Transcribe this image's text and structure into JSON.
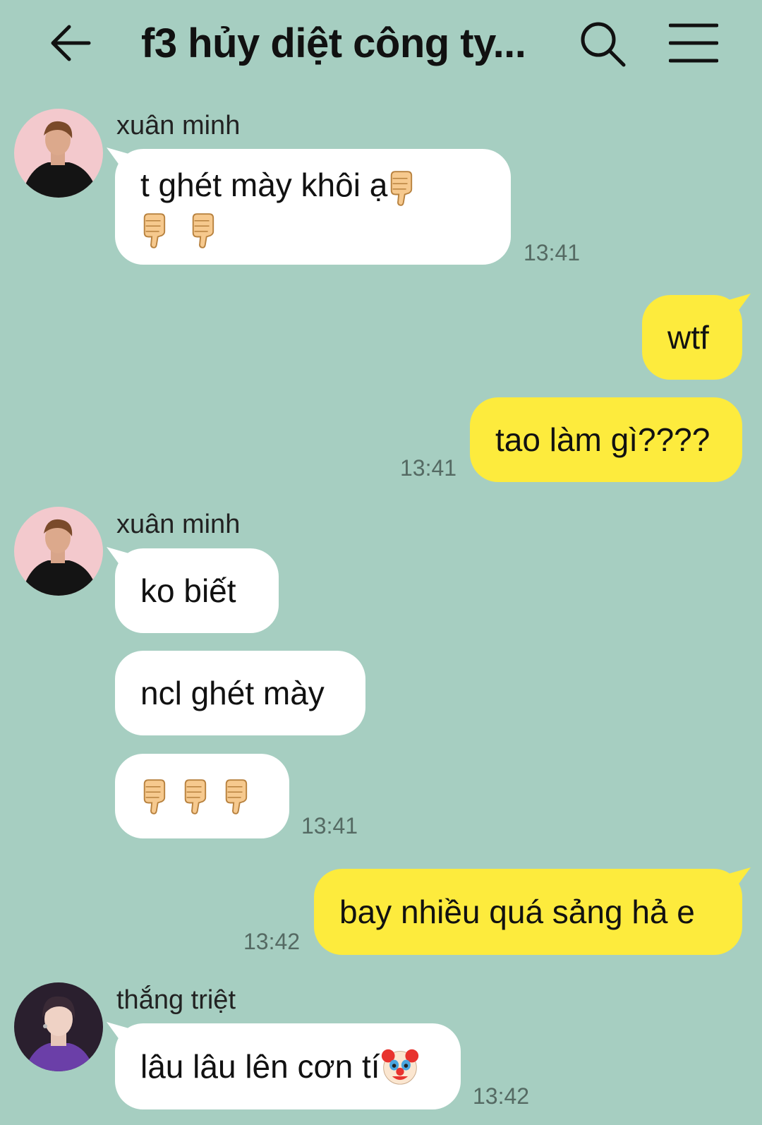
{
  "header": {
    "title": "f3 hủy diệt công ty...",
    "back_icon": "arrow-left-icon",
    "search_icon": "search-icon",
    "menu_icon": "menu-icon"
  },
  "colors": {
    "background": "#a6cec1",
    "incoming_bubble": "#ffffff",
    "outgoing_bubble": "#fdeb3d",
    "timestamp": "#556a63"
  },
  "messages": {
    "m1": {
      "sender": "xuân minh",
      "line1": "t ghét mày khôi ạ",
      "emoji": "thumbs-down-icon",
      "time": "13:41"
    },
    "m2": {
      "text": "wtf"
    },
    "m3": {
      "text": "tao làm gì????",
      "time": "13:41"
    },
    "m4": {
      "sender": "xuân minh",
      "text1": "ko biết",
      "text2": "ncl ghét mày",
      "emoji": "thumbs-down-icon",
      "time": "13:41"
    },
    "m5": {
      "text": "bay nhiều quá sảng hả e",
      "time": "13:42"
    },
    "m6": {
      "sender": "thắng triệt",
      "text": "lâu lâu lên cơn tí",
      "emoji": "clown-face-icon",
      "time": "13:42"
    }
  }
}
